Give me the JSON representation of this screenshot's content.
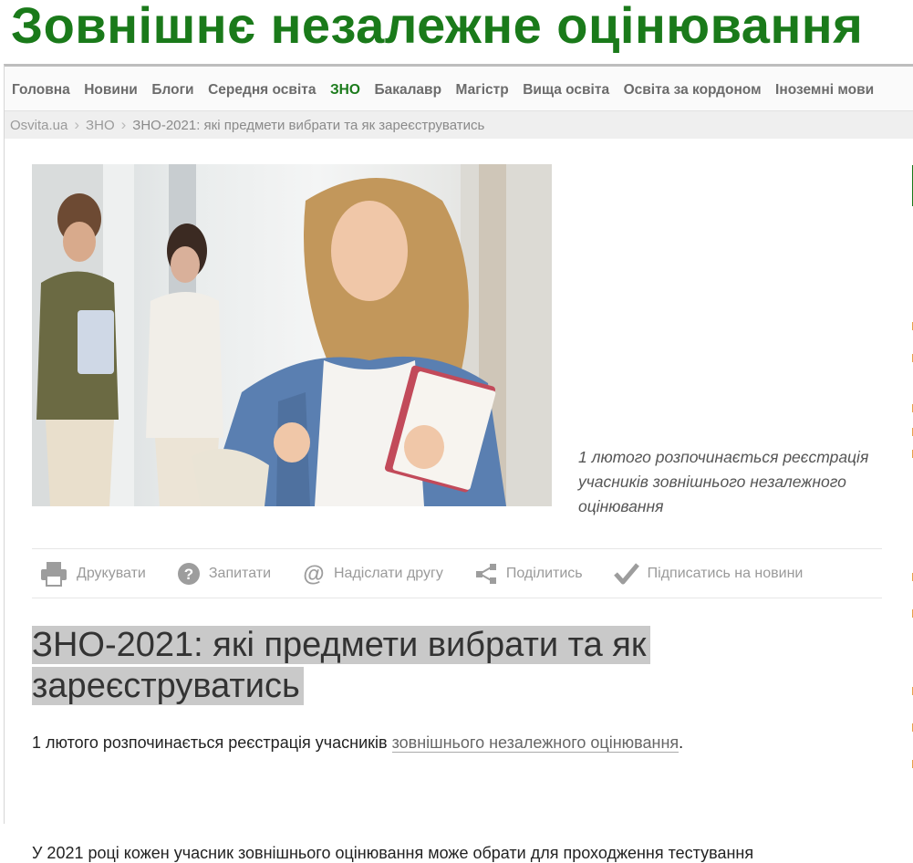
{
  "site": {
    "title": "Зовнішнє незалежне оцінювання"
  },
  "nav": {
    "items": [
      {
        "label": "Головна"
      },
      {
        "label": "Новини"
      },
      {
        "label": "Блоги"
      },
      {
        "label": "Середня освіта"
      },
      {
        "label": "ЗНО"
      },
      {
        "label": "Бакалавр"
      },
      {
        "label": "Магістр"
      },
      {
        "label": "Вища освіта"
      },
      {
        "label": "Освіта за кордоном"
      },
      {
        "label": "Іноземні мови"
      }
    ],
    "active": "ЗНО"
  },
  "breadcrumb": {
    "items": [
      "Osvita.ua",
      "ЗНО",
      "ЗНО-2021: які предмети вибрати та як зареєструватись"
    ]
  },
  "article": {
    "caption": "1 лютого розпочинається реєстрація учасників зовнішнього незалежного оцінювання",
    "headline": "ЗНО-2021: які предмети вибрати та як зареєструватись",
    "para1_text": "1 лютого розпочинається реєстрація учасників ",
    "para1_link": "зовнішнього незалежного оцінювання",
    "para1_end": ".",
    "para2": "У 2021 році кожен учасник зовнішнього оцінювання може обрати для проходження тестування"
  },
  "actions": {
    "print": "Друкувати",
    "ask": "Запитати",
    "send": "Надіслати другу",
    "share": "Поділитись",
    "subscribe": "Підписатись на новини"
  },
  "colors": {
    "brand": "#1a7a1a",
    "nav_text": "#6b6b6b",
    "muted": "#9a9a9a"
  }
}
